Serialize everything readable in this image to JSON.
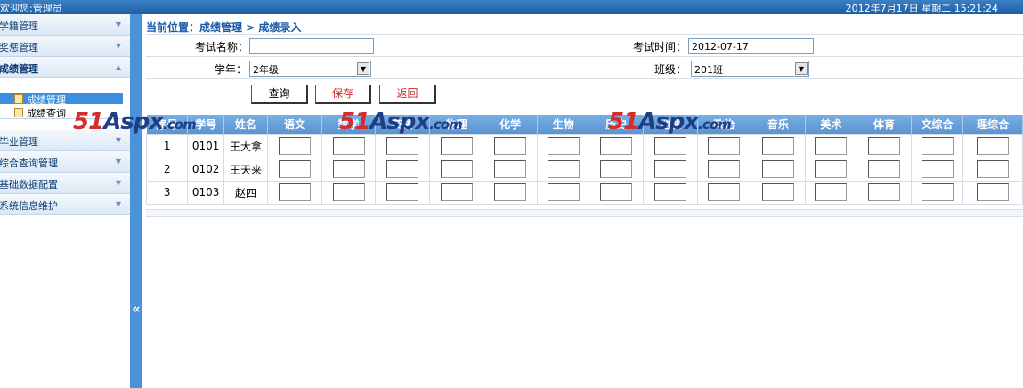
{
  "topbar": {
    "welcome": "欢迎您:管理员",
    "datetime": "2012年7月17日 星期二 15:21:24"
  },
  "sidebar": {
    "items": [
      {
        "label": "学籍管理"
      },
      {
        "label": "奖惩管理"
      },
      {
        "label": "成绩管理"
      },
      {
        "label": "毕业管理"
      },
      {
        "label": "综合查询管理"
      },
      {
        "label": "基础数据配置"
      },
      {
        "label": "系统信息维护"
      }
    ],
    "sub_items": [
      {
        "label": "成绩管理"
      },
      {
        "label": "成绩查询"
      }
    ]
  },
  "icons": {
    "collapse": "«"
  },
  "breadcrumb": "当前位置：成绩管理 > 成绩录入",
  "form": {
    "exam_name_label": "考试名称：",
    "exam_name_value": "",
    "exam_time_label": "考试时间：",
    "exam_time_value": "2012-07-17",
    "year_label": "学年：",
    "year_value": "2年级",
    "class_label": "班级：",
    "class_value": "201班",
    "query_button": "查询",
    "save_button": "保存",
    "back_button": "返回"
  },
  "table": {
    "headers": [
      "序号",
      "学号",
      "姓名",
      "语文",
      "数学",
      "英语",
      "物理",
      "化学",
      "生物",
      "历史",
      "地理",
      "政治",
      "音乐",
      "美术",
      "体育",
      "文综合",
      "理综合"
    ],
    "rows": [
      {
        "no": "1",
        "id": "0101",
        "name": "王大拿"
      },
      {
        "no": "2",
        "id": "0102",
        "name": "王天来"
      },
      {
        "no": "3",
        "id": "0103",
        "name": "赵四"
      }
    ]
  },
  "watermark": {
    "num": "51",
    "text": "Aspx",
    "com": ".com"
  },
  "colors": {
    "accent": "#4b92d8",
    "header": "#6aa3dc",
    "breadcrumb": "#1b5aa8",
    "watermark_red": "#d62b2b",
    "watermark_blue": "#1e3f86"
  }
}
